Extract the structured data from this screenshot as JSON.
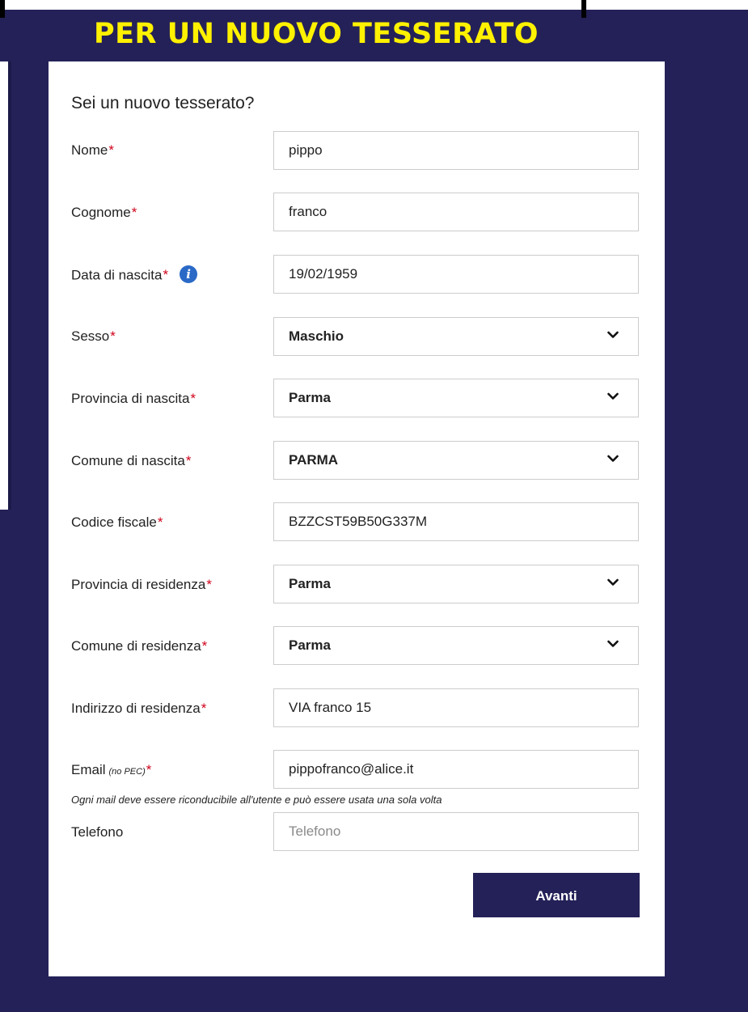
{
  "header": {
    "title": "PER UN NUOVO TESSERATO"
  },
  "form": {
    "heading": "Sei un nuovo tesserato?",
    "required_mark": "*",
    "fields": {
      "nome": {
        "label": "Nome",
        "value": "pippo"
      },
      "cognome": {
        "label": "Cognome",
        "value": "franco"
      },
      "data_nascita": {
        "label": "Data di nascita",
        "value": "19/02/1959",
        "info_icon": "info-icon"
      },
      "sesso": {
        "label": "Sesso",
        "value": "Maschio"
      },
      "provincia_nascita": {
        "label": "Provincia di nascita",
        "value": "Parma"
      },
      "comune_nascita": {
        "label": "Comune di nascita",
        "value": "PARMA"
      },
      "codice_fiscale": {
        "label": "Codice fiscale",
        "value": "BZZCST59B50G337M"
      },
      "provincia_residenza": {
        "label": "Provincia di residenza",
        "value": "Parma"
      },
      "comune_residenza": {
        "label": "Comune di residenza",
        "value": "Parma"
      },
      "indirizzo_residenza": {
        "label": "Indirizzo di residenza",
        "value": "VIA franco 15"
      },
      "email": {
        "label": "Email",
        "note": "(no PEC)",
        "value": "pippofranco@alice.it"
      },
      "telefono": {
        "label": "Telefono",
        "value": "",
        "placeholder": "Telefono"
      }
    },
    "email_hint": "Ogni mail deve essere riconducibile all'utente e può essere usata una sola volta",
    "submit_label": "Avanti"
  },
  "colors": {
    "background": "#242158",
    "title": "#fff100",
    "required": "#d0021b",
    "info": "#2a69c6",
    "button": "#242158"
  }
}
